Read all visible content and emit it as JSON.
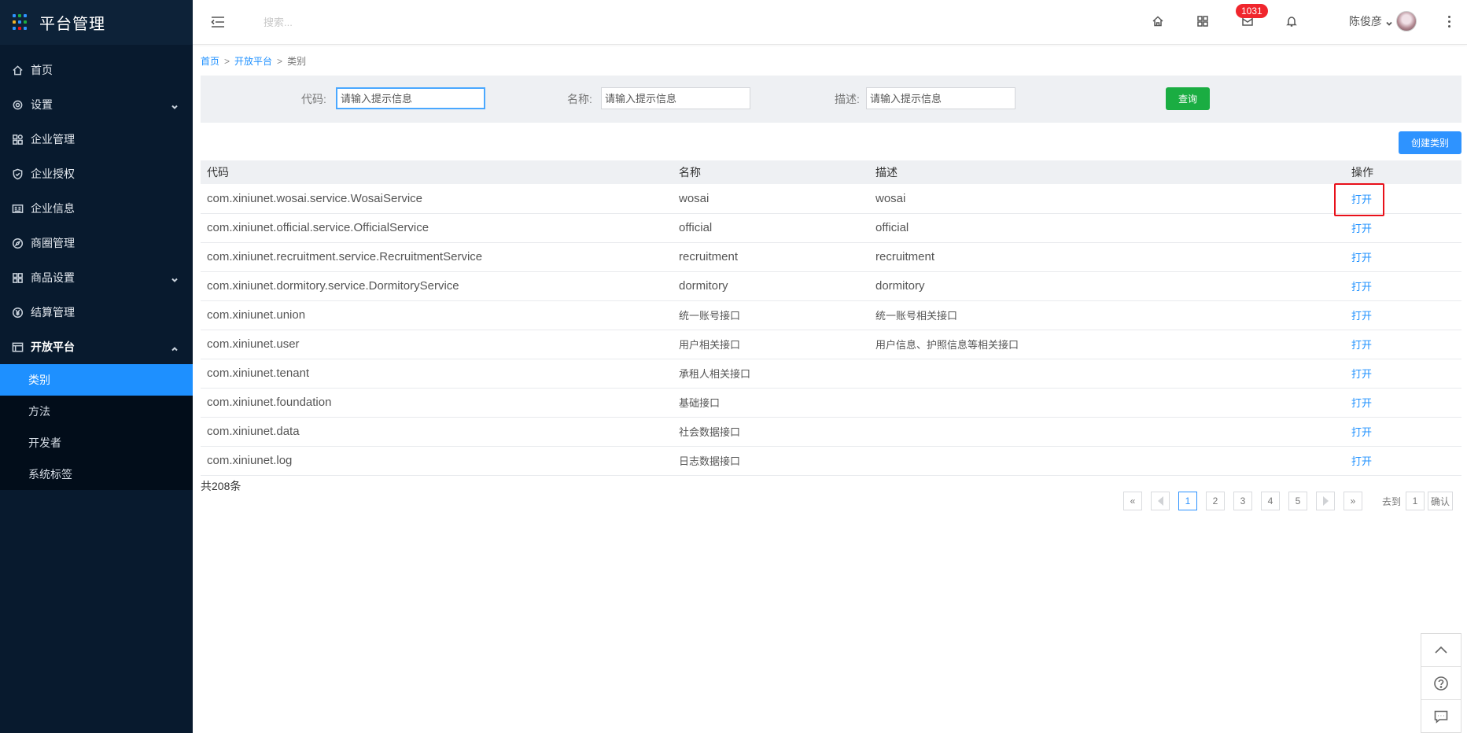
{
  "app": {
    "title": "平台管理"
  },
  "sidebar": {
    "items": [
      {
        "label": "首页",
        "icon": "home-icon"
      },
      {
        "label": "设置",
        "icon": "gear-icon",
        "expandable": true
      },
      {
        "label": "企业管理",
        "icon": "apps-icon"
      },
      {
        "label": "企业授权",
        "icon": "shield-icon"
      },
      {
        "label": "企业信息",
        "icon": "idcard-icon"
      },
      {
        "label": "商圈管理",
        "icon": "compass-icon"
      },
      {
        "label": "商品设置",
        "icon": "grid-icon",
        "expandable": true
      },
      {
        "label": "结算管理",
        "icon": "yen-icon"
      },
      {
        "label": "开放平台",
        "icon": "table-icon",
        "expanded": true
      }
    ],
    "subitems": [
      {
        "label": "类别",
        "active": true
      },
      {
        "label": "方法"
      },
      {
        "label": "开发者"
      },
      {
        "label": "系统标签"
      }
    ]
  },
  "header": {
    "search_placeholder": "搜索...",
    "badge_count": "1031",
    "user_name": "陈俊彦"
  },
  "breadcrumb": {
    "home": "首页",
    "parent": "开放平台",
    "current": "类别",
    "separator": ">"
  },
  "filter": {
    "code_label": "代码:",
    "name_label": "名称:",
    "desc_label": "描述:",
    "placeholder": "请输入提示信息",
    "query_button": "查询"
  },
  "create_button": "创建类别",
  "table": {
    "columns": [
      "代码",
      "名称",
      "描述",
      "操作"
    ],
    "action_label": "打开",
    "rows": [
      {
        "code": "com.xiniunet.wosai.service.WosaiService",
        "name": "wosai",
        "desc": "wosai"
      },
      {
        "code": "com.xiniunet.official.service.OfficialService",
        "name": "official",
        "desc": "official"
      },
      {
        "code": "com.xiniunet.recruitment.service.RecruitmentService",
        "name": "recruitment",
        "desc": "recruitment"
      },
      {
        "code": "com.xiniunet.dormitory.service.DormitoryService",
        "name": "dormitory",
        "desc": "dormitory"
      },
      {
        "code": "com.xiniunet.union",
        "name": "统一账号接口",
        "desc": "统一账号相关接口"
      },
      {
        "code": "com.xiniunet.user",
        "name": "用户相关接口",
        "desc": "用户信息、护照信息等相关接口"
      },
      {
        "code": "com.xiniunet.tenant",
        "name": "承租人相关接口",
        "desc": ""
      },
      {
        "code": "com.xiniunet.foundation",
        "name": "基础接口",
        "desc": ""
      },
      {
        "code": "com.xiniunet.data",
        "name": "社会数据接口",
        "desc": ""
      },
      {
        "code": "com.xiniunet.log",
        "name": "日志数据接口",
        "desc": ""
      }
    ]
  },
  "total": "共208条",
  "pagination": {
    "first": "«",
    "last": "»",
    "pages": [
      "1",
      "2",
      "3",
      "4",
      "5"
    ],
    "current": "1",
    "goto_label": "去到",
    "goto_value": "1",
    "confirm": "确认"
  },
  "colors": {
    "sidebar_bg": "#081a2e",
    "active": "#1e90ff",
    "query": "#1aad42",
    "highlight": "#e8101a"
  }
}
